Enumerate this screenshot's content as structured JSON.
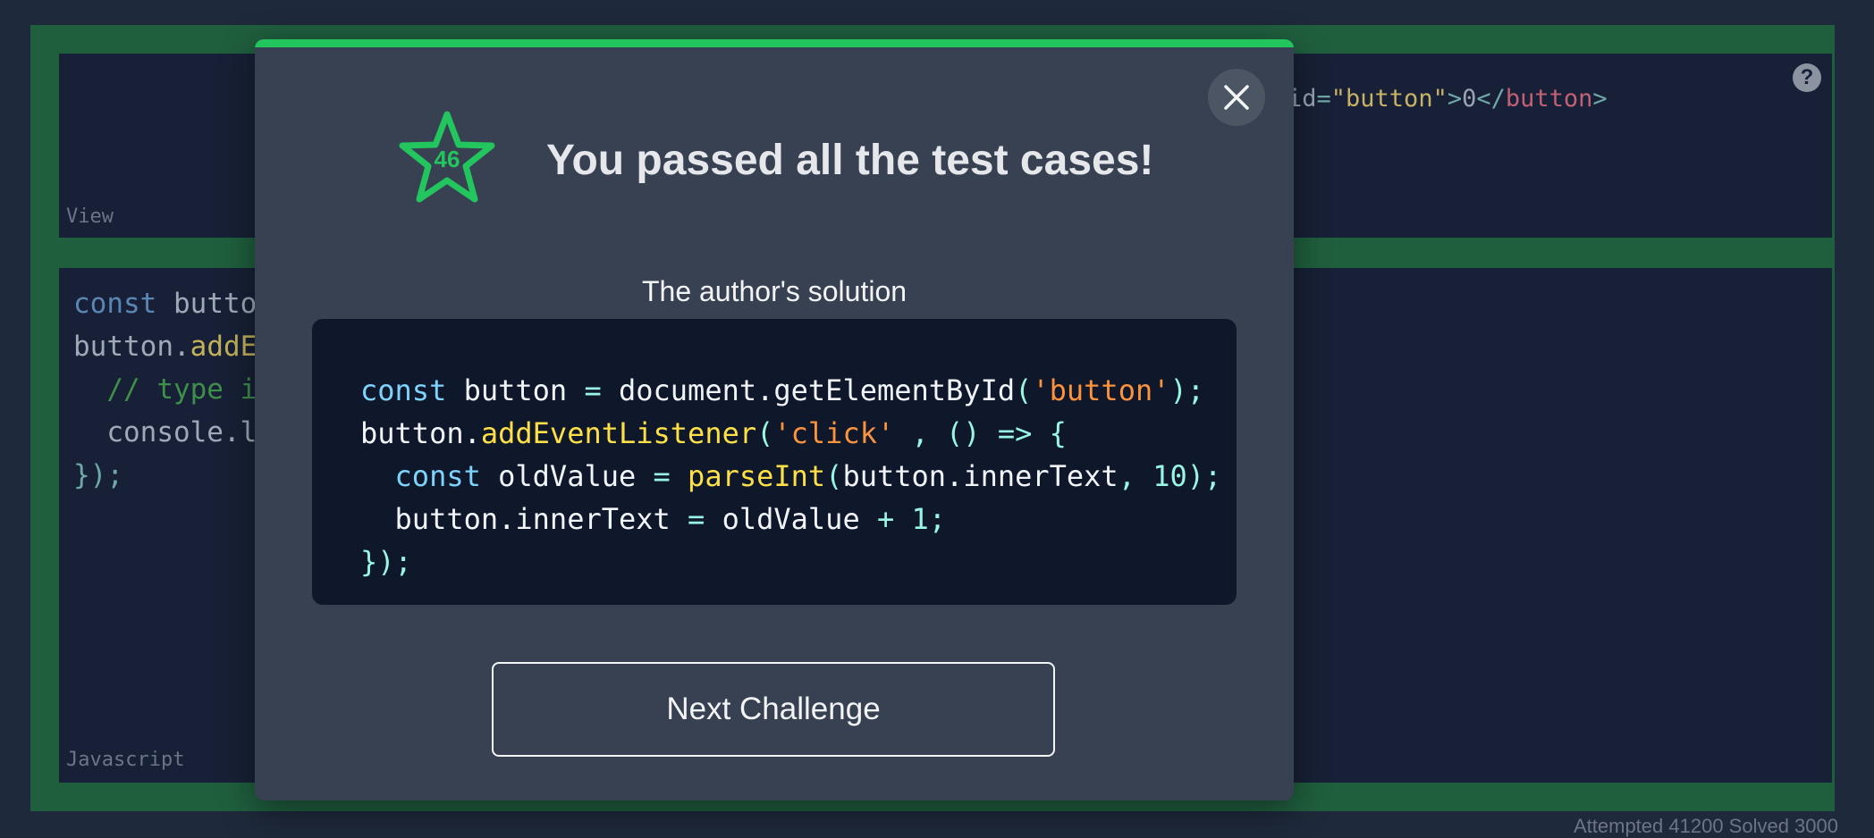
{
  "editor": {
    "view_label": "View",
    "js_label": "Javascript",
    "html_snippet": {
      "attr_name": "id",
      "attr_value": "\"button\"",
      "text": "0",
      "close_tag": "button"
    },
    "js_lines": {
      "l1_kw": "const",
      "l1_rest": " butto",
      "l2_obj": "button.",
      "l2_fn": "addE",
      "l3_comment": "  // type i",
      "l4": "  console.l",
      "l5": "});"
    },
    "status_text": "Attempted 41200 Solved 3000"
  },
  "modal": {
    "score": "46",
    "title": "You passed all the test cases!",
    "solution_title": "The author's solution",
    "next_button": "Next Challenge"
  },
  "colors": {
    "accent": "#22c55e",
    "modal_bg": "#374151",
    "code_bg": "#0f172a"
  },
  "icons": [
    "close-icon",
    "star-icon",
    "help-icon"
  ]
}
